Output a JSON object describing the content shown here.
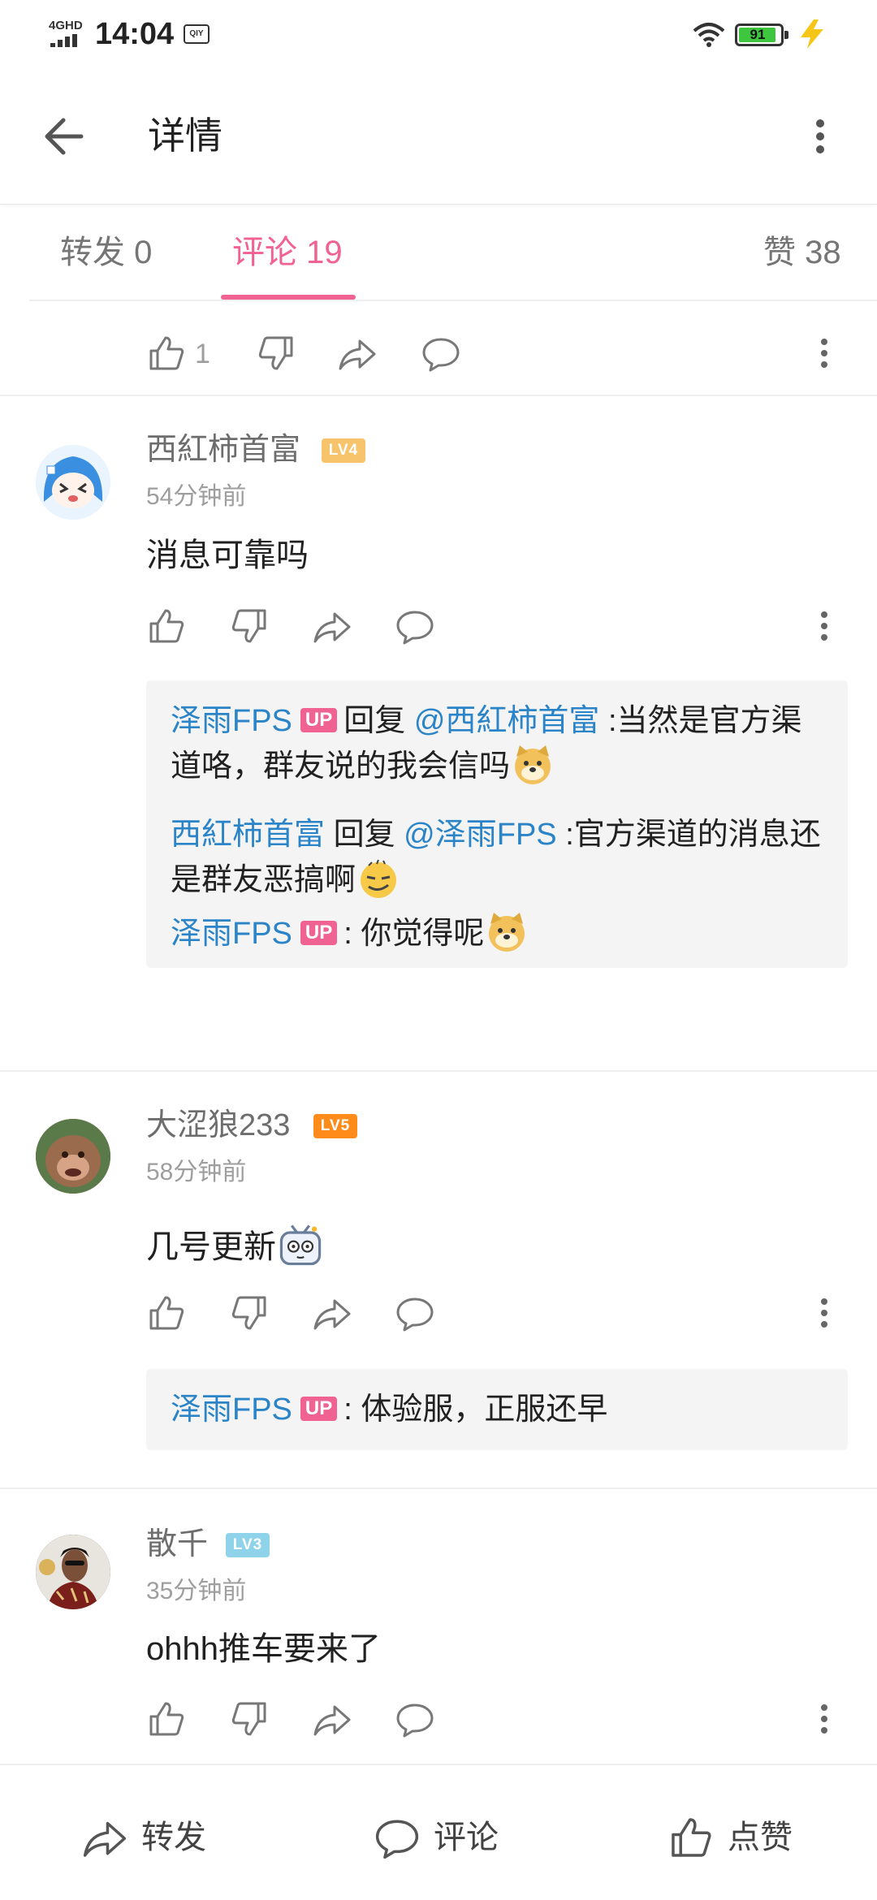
{
  "status_bar": {
    "network": "4GHD",
    "time": "14:04",
    "app_badge": "QIY",
    "battery": "91",
    "colors": {
      "battery_fill": "#3fc63f",
      "charging": "#f5c518"
    }
  },
  "header": {
    "title": "详情"
  },
  "tabs": [
    {
      "label": "转发 0"
    },
    {
      "label": "评论 19"
    },
    {
      "label": "赞 38"
    }
  ],
  "top_action": {
    "like_count": "1"
  },
  "comments": [
    {
      "username": "西紅柿首富",
      "level": "LV4",
      "time": "54分钟前",
      "content": "消息可靠吗",
      "replies": {
        "r1_user": "泽雨FPS",
        "r1_badge": "UP",
        "r1_verb": "回复",
        "r1_at": "@西紅柿首富",
        "r1_text": ":当然是官方渠道咯，群友说的我会信吗",
        "r2_user": "西紅柿首富",
        "r2_verb": "回复",
        "r2_at": "@泽雨FPS",
        "r2_text": ":官方渠道的消息还是群友恶搞啊",
        "r3_user": "泽雨FPS",
        "r3_badge": "UP",
        "r3_text": ": 你觉得呢"
      }
    },
    {
      "username": "大涩狼233",
      "level": "LV5",
      "time": "58分钟前",
      "content": "几号更新",
      "replies": {
        "r1_user": "泽雨FPS",
        "r1_badge": "UP",
        "r1_text": ": 体验服，正服还早"
      }
    },
    {
      "username": "散千",
      "level": "LV3",
      "time": "35分钟前",
      "content": "ohhh推车要来了"
    }
  ],
  "bottom_bar": {
    "repost": "转发",
    "comment": "评论",
    "like": "点赞"
  },
  "colors": {
    "accent_pink": "#f06292",
    "link_blue": "#2a84c7",
    "lv3": "#8fd3ea",
    "lv4": "#f7c36b",
    "lv5": "#ff8c1a"
  }
}
